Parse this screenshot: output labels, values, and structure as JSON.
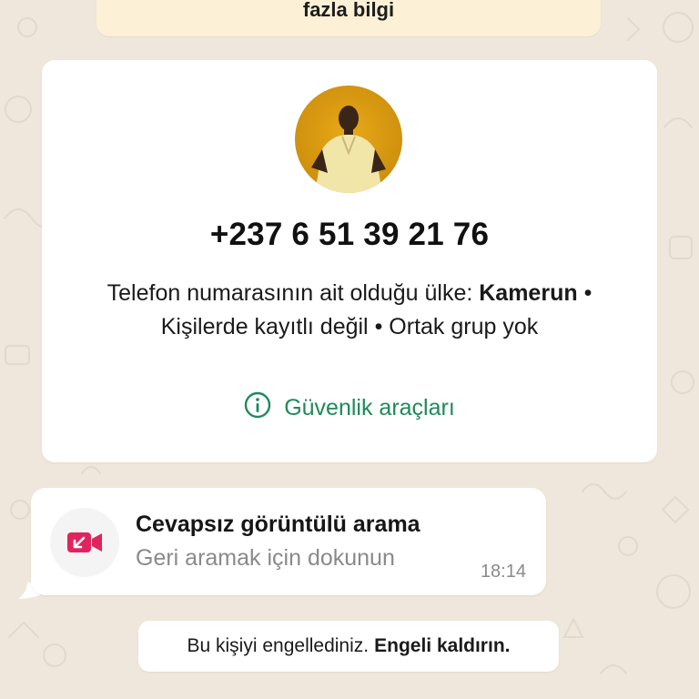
{
  "banner": {
    "text": "fazla bilgi"
  },
  "contact": {
    "phone": "+237 6 51 39 21 76",
    "country_prefix": "Telefon numarasının ait olduğu ülke:",
    "country": "Kamerun",
    "separator": "•",
    "not_saved": "Kişilerde kayıtlı değil",
    "no_groups": "Ortak grup yok",
    "safety_tools": "Güvenlik araçları"
  },
  "call": {
    "title": "Cevapsız görüntülü arama",
    "subtitle": "Geri aramak için dokunun",
    "time": "18:14",
    "icon_color": "#e0245e"
  },
  "blocked": {
    "text": "Bu kişiyi engellediniz.",
    "action": "Engeli kaldırın."
  },
  "colors": {
    "accent_green": "#1e8a5a",
    "wallpaper": "#efe7dc",
    "banner": "#fcf1d6"
  }
}
